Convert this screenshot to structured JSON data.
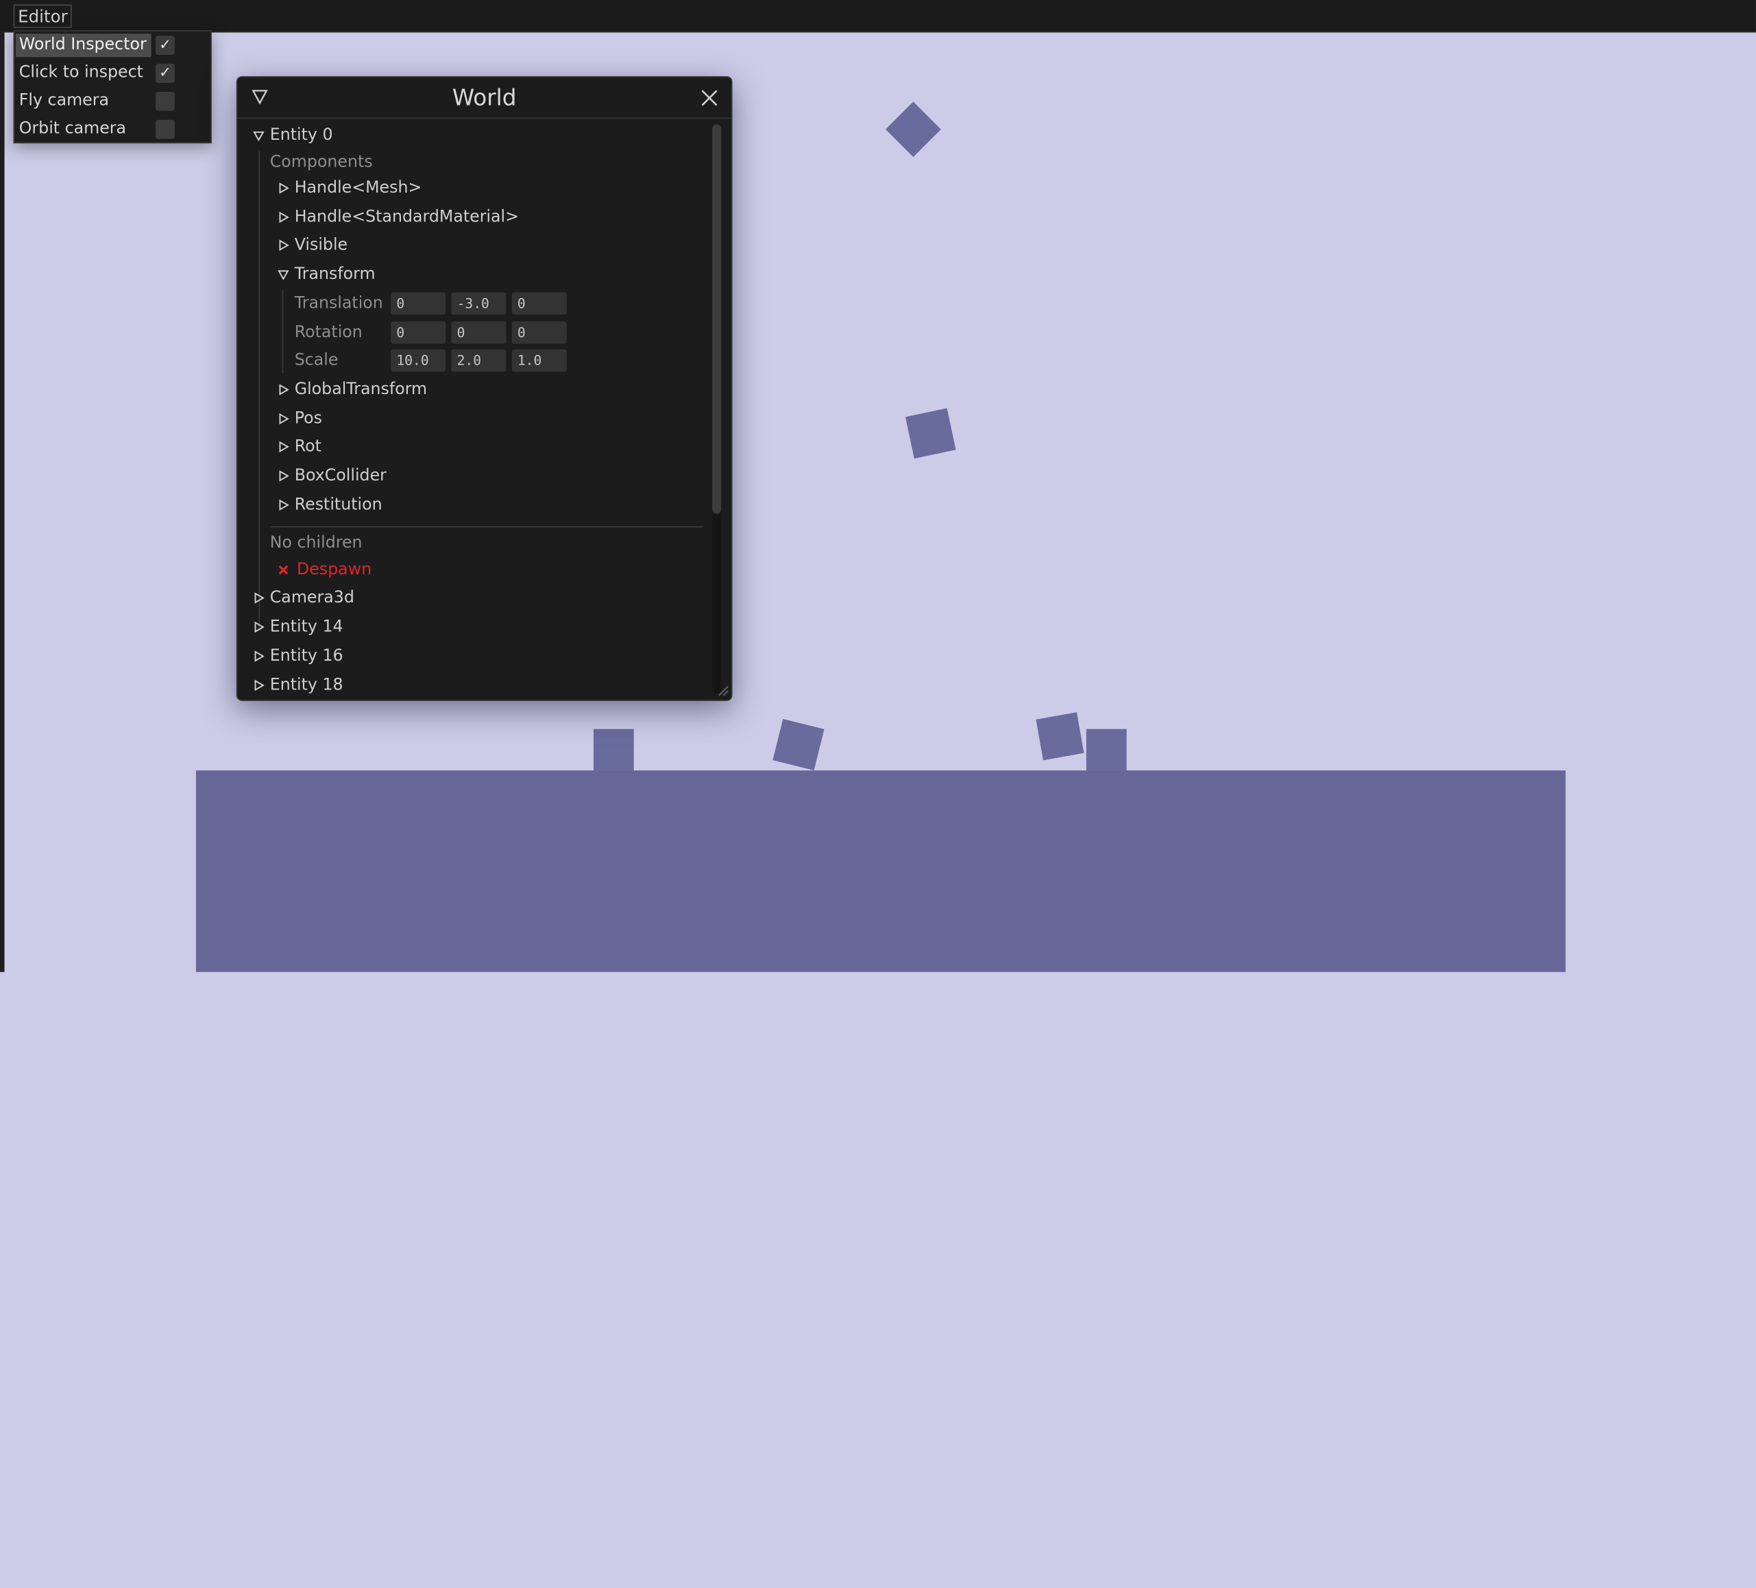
{
  "menubar": {
    "editor_label": "Editor"
  },
  "editor_menu": [
    {
      "label": "World Inspector",
      "checked": true
    },
    {
      "label": "Click to inspect",
      "checked": true
    },
    {
      "label": "Fly camera",
      "checked": false
    },
    {
      "label": "Orbit camera",
      "checked": false
    }
  ],
  "world_window": {
    "title": "World",
    "entity0": {
      "label": "Entity 0",
      "components_label": "Components",
      "components": {
        "handle_mesh": "Handle<Mesh>",
        "handle_material": "Handle<StandardMaterial>",
        "visible": "Visible",
        "transform": "Transform",
        "global_transform": "GlobalTransform",
        "pos": "Pos",
        "rot": "Rot",
        "box_collider": "BoxCollider",
        "restitution": "Restitution"
      },
      "transform_fields": {
        "translation": {
          "label": "Translation",
          "values": [
            "0",
            "-3.0",
            "0"
          ]
        },
        "rotation": {
          "label": "Rotation",
          "values": [
            "0",
            "0",
            "0"
          ]
        },
        "scale": {
          "label": "Scale",
          "values": [
            "10.0",
            "2.0",
            "1.0"
          ]
        }
      },
      "no_children": "No children",
      "despawn": "Despawn"
    },
    "entities": [
      "Camera3d",
      "Entity 14",
      "Entity 16",
      "Entity 18"
    ]
  },
  "colors": {
    "background": "#cdcce8",
    "cube": "#6a6b9d",
    "ground": "#676797",
    "panel": "#1c1c1c",
    "despawn": "#e0262c"
  }
}
